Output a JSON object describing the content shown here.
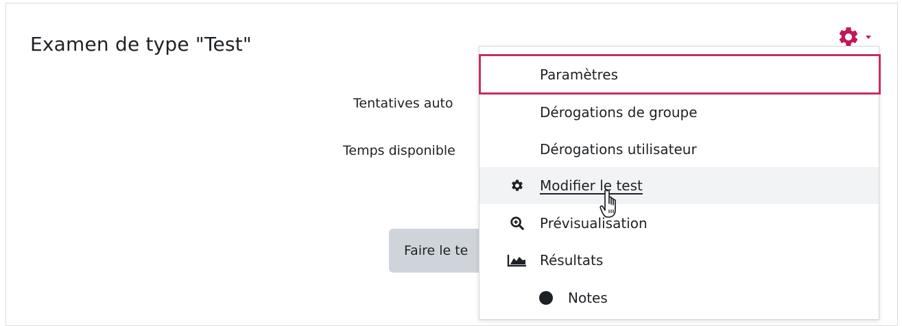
{
  "page": {
    "title": "Examen de type \"Test\"",
    "attempts_label": "Tentatives auto",
    "time_label": "Temps disponible",
    "start_button": "Faire le te"
  },
  "settings_menu": {
    "trigger_icon": "gear-icon",
    "accent_color": "#c2185b",
    "items": [
      {
        "label": "Paramètres",
        "icon": null,
        "highlighted": true
      },
      {
        "label": "Dérogations de groupe",
        "icon": null
      },
      {
        "label": "Dérogations utilisateur",
        "icon": null
      },
      {
        "label": "Modifier le test",
        "icon": "gear-icon",
        "hovered": true
      },
      {
        "label": "Prévisualisation",
        "icon": "zoom-in-icon"
      },
      {
        "label": "Résultats",
        "icon": "area-chart-icon"
      },
      {
        "label": "Notes",
        "icon": "dot-icon"
      }
    ]
  }
}
